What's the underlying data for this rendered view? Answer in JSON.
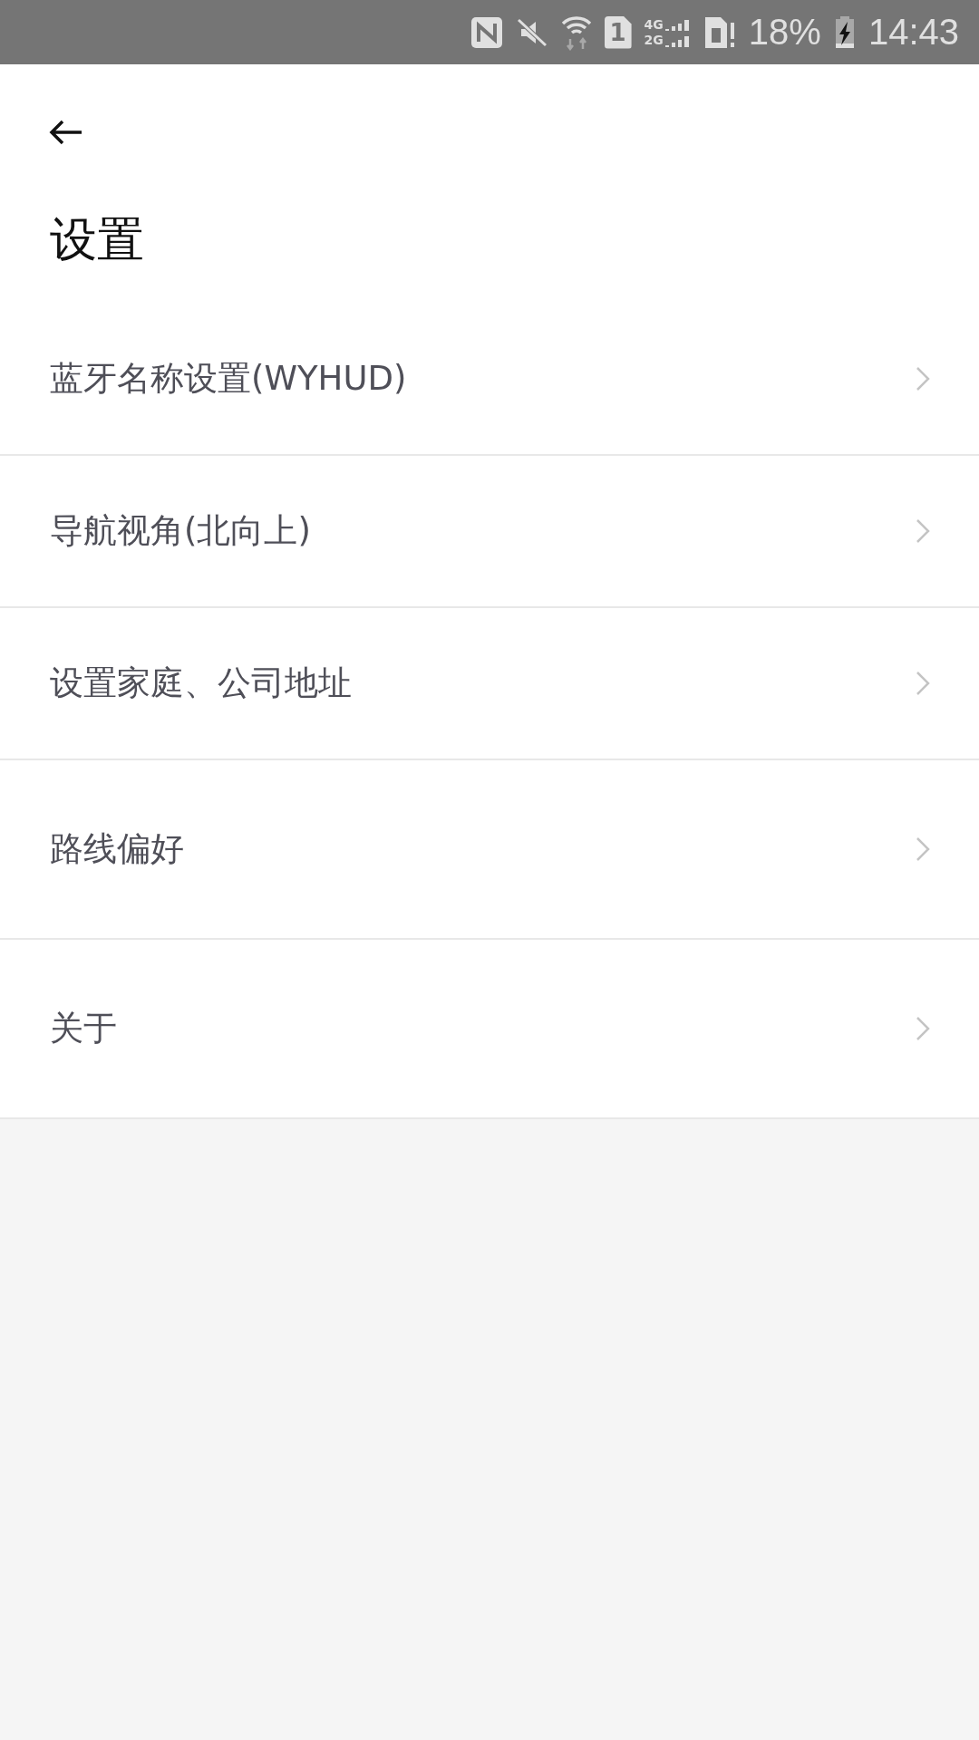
{
  "status_bar": {
    "sim_slot": "1",
    "network_top": "4G",
    "network_bottom": "2G",
    "battery": "18%",
    "time": "14:43"
  },
  "header": {
    "title": "设置"
  },
  "settings": [
    {
      "label": "蓝牙名称设置(WYHUD)"
    },
    {
      "label": "导航视角(北向上)"
    },
    {
      "label": "设置家庭、公司地址"
    },
    {
      "label": "路线偏好"
    },
    {
      "label": "关于"
    }
  ]
}
